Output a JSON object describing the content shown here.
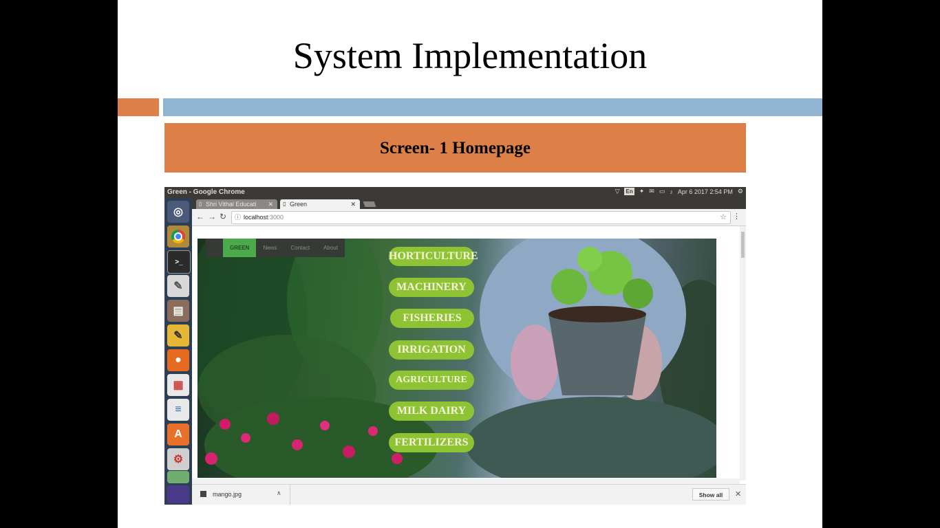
{
  "slide": {
    "title": "System Implementation",
    "banner": "Screen- 1 Homepage"
  },
  "window": {
    "title": "Green - Google Chrome",
    "tray": {
      "keyboard": "En",
      "date": "Apr 6 2017",
      "time": "2:54 PM"
    }
  },
  "tabs": [
    {
      "label": "Shri Vithal Educati",
      "active": false
    },
    {
      "label": "Green",
      "active": true
    }
  ],
  "address": {
    "host": "localhost",
    "port": ":3000"
  },
  "site": {
    "nav": [
      {
        "label": "GREEN",
        "active": true
      },
      {
        "label": "News",
        "active": false
      },
      {
        "label": "Contact",
        "active": false
      },
      {
        "label": "About",
        "active": false
      }
    ],
    "categories": [
      "HORTICULTURE",
      "MACHINERY",
      "FISHERIES",
      "IRRIGATION",
      "AGRICULTURE",
      "MILK DAIRY",
      "FERTILIZERS"
    ]
  },
  "downloads": {
    "file": "mango.jpg",
    "show_all": "Show all"
  },
  "launcher": [
    "ubuntu-dash-icon",
    "chrome-icon",
    "terminal-icon",
    "text-editor-icon",
    "file-manager-icon",
    "notes-icon",
    "firefox-icon",
    "impress-icon",
    "writer-icon",
    "software-center-icon",
    "settings-icon",
    "disk-icon",
    "workspace-switcher-icon"
  ],
  "colors": {
    "accent": "#dc8048",
    "blue_bar": "#92b4d3",
    "category_button": "#8ec333",
    "nav_active": "#4caa4c"
  }
}
